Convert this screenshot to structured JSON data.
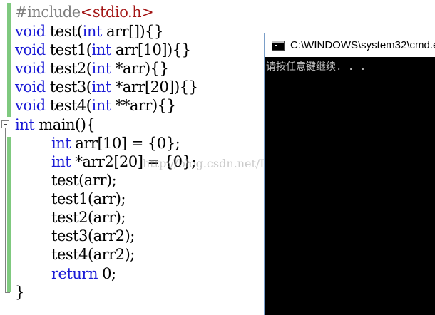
{
  "editor": {
    "lines": {
      "l1": {
        "directive": "#include",
        "header": "<stdio.h>"
      },
      "l2": {
        "kw": "void",
        "rest": " test(",
        "kw2": "int",
        "rest2": " arr[]){}"
      },
      "l3": {
        "kw": "void",
        "rest": " test1(",
        "kw2": "int",
        "rest2": " arr[10]){}"
      },
      "l4": {
        "kw": "void",
        "rest": " test2(",
        "kw2": "int",
        "rest2": " *arr){}"
      },
      "l5": {
        "kw": "void",
        "rest": " test3(",
        "kw2": "int",
        "rest2": " *arr[20]){}"
      },
      "l6": {
        "kw": "void",
        "rest": " test4(",
        "kw2": "int",
        "rest2": " **arr){}"
      },
      "l7": {
        "kw": "int",
        "rest": " main(){"
      },
      "l8": {
        "kw": "int",
        "rest": " arr[10] = {0};"
      },
      "l9": {
        "kw": "int",
        "rest": " *arr2[20] = {0};"
      },
      "l10": {
        "text": "test(arr);"
      },
      "l11": {
        "text": "test1(arr);"
      },
      "l12": {
        "text": "test2(arr);"
      },
      "l13": {
        "text": "test3(arr2);"
      },
      "l14": {
        "text": "test4(arr2);"
      },
      "l15": {
        "kw": "return",
        "rest": " 0;"
      },
      "l16": {
        "text": "}"
      }
    },
    "watermark": "http://blog.csdn.net/DY_1024",
    "colors": {
      "keyword": "#1b1bd6",
      "preprocessor": "#7f7f7f",
      "include_path": "#a31515",
      "gutter": "#7fc97f"
    }
  },
  "console": {
    "title": "C:\\WINDOWS\\system32\\cmd.exe",
    "icon": "console-app-icon",
    "output": "请按任意键继续. . ."
  }
}
